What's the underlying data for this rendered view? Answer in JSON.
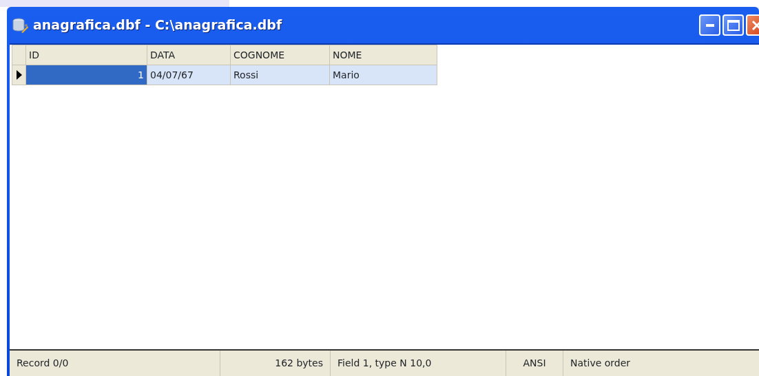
{
  "window": {
    "title": "anagrafica.dbf - C:\\anagrafica.dbf"
  },
  "table": {
    "columns": [
      "ID",
      "DATA",
      "COGNOME",
      "NOME"
    ],
    "rows": [
      {
        "selected": true,
        "cells": [
          {
            "text": "1",
            "focused": true
          },
          {
            "text": "04/07/67",
            "focused": false
          },
          {
            "text": "Rossi",
            "focused": false
          },
          {
            "text": "Mario",
            "focused": false
          }
        ]
      }
    ]
  },
  "status_bar": [
    "Record 0/0",
    "162 bytes",
    "Field 1, type N 10,0",
    "ANSI",
    "Native order"
  ]
}
